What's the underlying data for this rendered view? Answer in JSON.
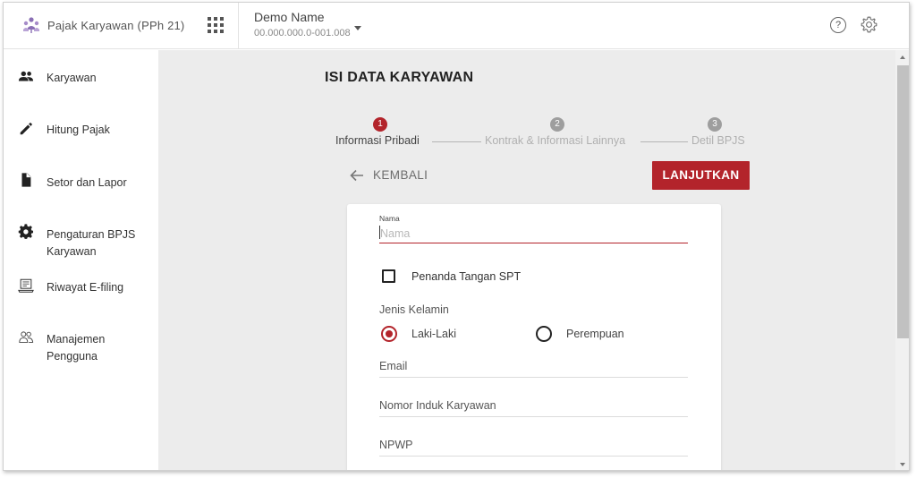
{
  "app": {
    "title": "Pajak Karyawan (PPh 21)",
    "brand_icon": "people-tree-icon",
    "apps_icon": "apps-grid-icon"
  },
  "company": {
    "name": "Demo Name",
    "npwp": "00.000.000.0-001.008"
  },
  "header_icons": {
    "help": "?",
    "settings": "gear-icon"
  },
  "sidebar": {
    "items": [
      {
        "label": "Karyawan",
        "icon": "people-icon"
      },
      {
        "label": "Hitung Pajak",
        "icon": "pencil-icon"
      },
      {
        "label": "Setor dan Lapor",
        "icon": "document-icon"
      },
      {
        "label": "Pengaturan BPJS Karyawan",
        "icon": "gear-icon"
      },
      {
        "label": "Riwayat E-filing",
        "icon": "laptop-icon"
      },
      {
        "label": "Manajemen Pengguna",
        "icon": "users-outline-icon"
      }
    ]
  },
  "main": {
    "title": "ISI DATA KARYAWAN",
    "steps": [
      {
        "number": "1",
        "label": "Informasi Pribadi",
        "active": true
      },
      {
        "number": "2",
        "label": "Kontrak & Informasi Lainnya",
        "active": false
      },
      {
        "number": "3",
        "label": "Detil BPJS",
        "active": false
      }
    ],
    "back_label": "KEMBALI",
    "next_label": "LANJUTKAN"
  },
  "form": {
    "name_label": "Nama",
    "name_placeholder": "Nama",
    "name_value": "",
    "signer_label": "Penanda Tangan SPT",
    "signer_checked": false,
    "gender_title": "Jenis Kelamin",
    "gender_options": [
      {
        "label": "Laki-Laki",
        "selected": true
      },
      {
        "label": "Perempuan",
        "selected": false
      }
    ],
    "email_label": "Email",
    "employee_id_label": "Nomor Induk Karyawan",
    "npwp_label": "NPWP"
  },
  "colors": {
    "accent": "#b3242b",
    "step_inactive": "#9e9e9e",
    "background": "#ececec"
  }
}
